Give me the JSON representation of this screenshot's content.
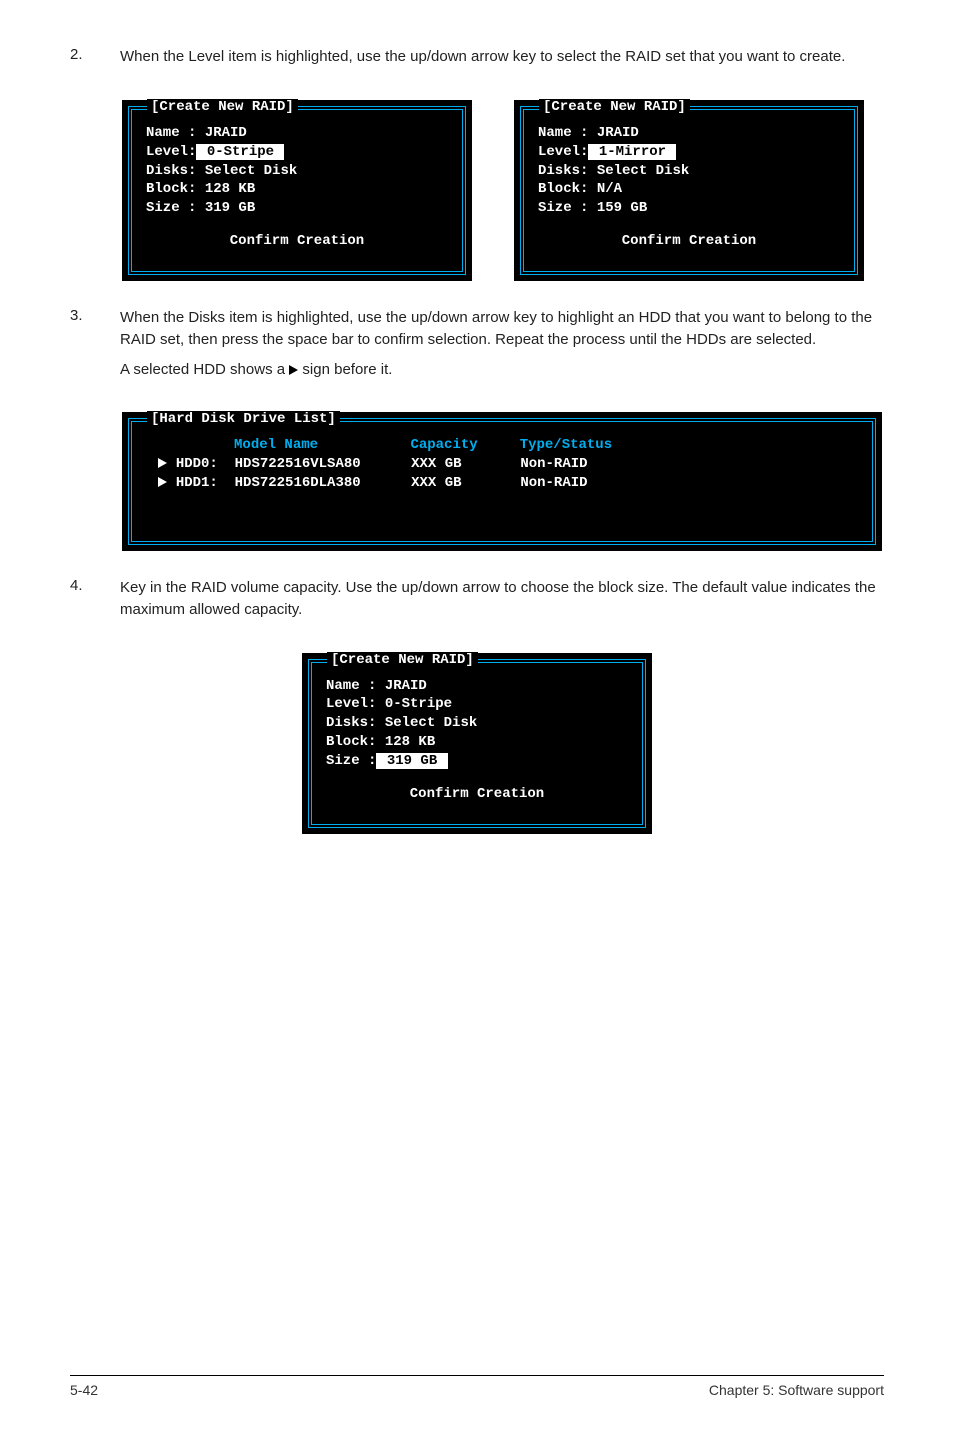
{
  "steps": {
    "s2": {
      "num": "2.",
      "text": "When the Level item is highlighted, use the up/down arrow key to select the RAID set that you want to create."
    },
    "s3": {
      "num": "3.",
      "text": "When the Disks item is highlighted, use the up/down arrow key to highlight an HDD that you want to belong to the RAID set, then press the space bar to confirm selection. Repeat the process until the HDDs are selected.",
      "sub_before": "A selected HDD shows a",
      "sub_after": "sign before it."
    },
    "s4": {
      "num": "4.",
      "text": "Key in the RAID volume capacity. Use the up/down arrow to choose the block size. The default value indicates the maximum allowed capacity."
    }
  },
  "panelA": {
    "title": "[Create New RAID]",
    "name_l": "Name :",
    "name_v": "JRAID",
    "level_l": "Level:",
    "level_v": " 0-Stripe ",
    "disks_l": "Disks:",
    "disks_v": "Select Disk",
    "block_l": "Block:",
    "block_v": "128 KB",
    "size_l": "Size :",
    "size_v": "319 GB",
    "confirm": "Confirm Creation"
  },
  "panelB": {
    "title": "[Create New RAID]",
    "name_l": "Name :",
    "name_v": "JRAID",
    "level_l": "Level:",
    "level_v": " 1-Mirror ",
    "disks_l": "Disks:",
    "disks_v": "Select Disk",
    "block_l": "Block:",
    "block_v": "N/A",
    "size_l": "Size :",
    "size_v": "159 GB",
    "confirm": "Confirm Creation"
  },
  "panelC": {
    "title": "[Hard Disk Drive List]",
    "h_model": "Model Name",
    "h_cap": "Capacity",
    "h_type": "Type/Status",
    "r0": {
      "id": "HDD0:",
      "model": "HDS722516VLSA80",
      "cap": "XXX GB",
      "type": "Non-RAID"
    },
    "r1": {
      "id": "HDD1:",
      "model": "HDS722516DLA380",
      "cap": "XXX GB",
      "type": "Non-RAID"
    }
  },
  "panelD": {
    "title": "[Create New RAID]",
    "name_l": "Name :",
    "name_v": "JRAID",
    "level_l": "Level:",
    "level_v": "0-Stripe",
    "disks_l": "Disks:",
    "disks_v": "Select Disk",
    "block_l": "Block:",
    "block_v": "128 KB",
    "size_l": "Size :",
    "size_v": " 319 GB ",
    "confirm": "Confirm Creation"
  },
  "footer": {
    "left": "5-42",
    "right": "Chapter 5: Software support"
  }
}
